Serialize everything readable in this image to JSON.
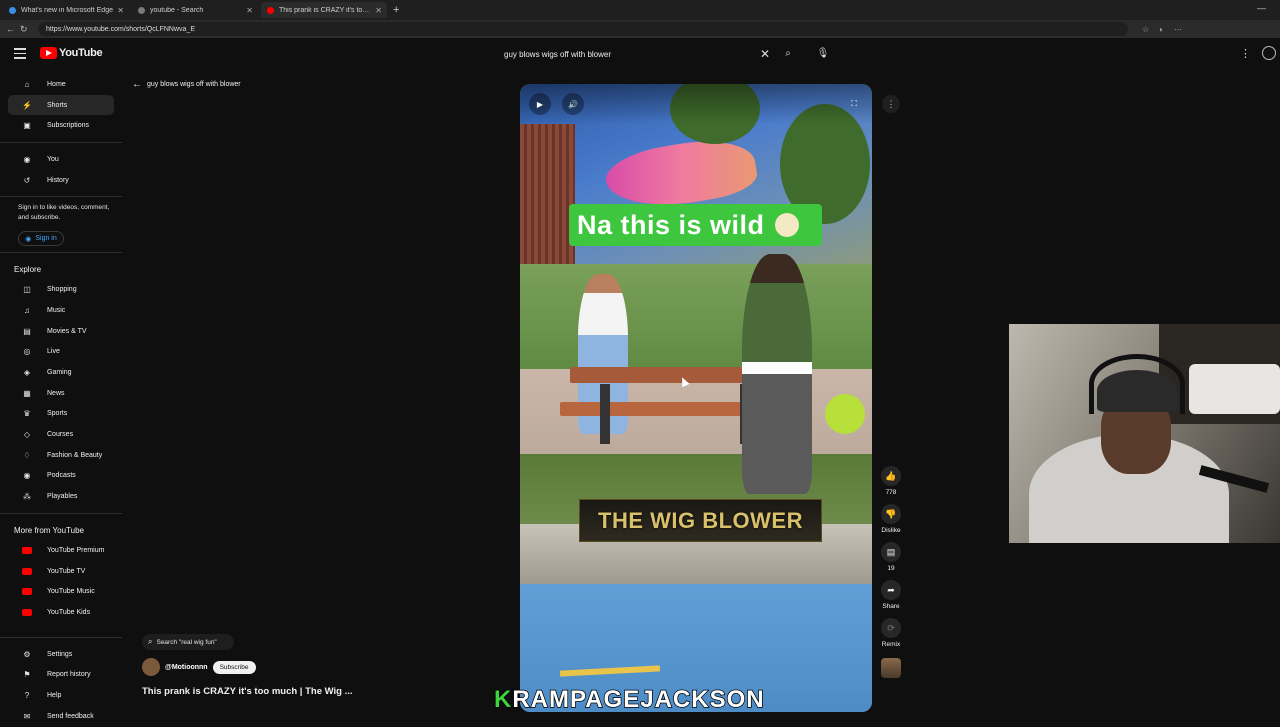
{
  "browser": {
    "tabs": [
      {
        "title": "What's new in Microsoft Edge",
        "color": "#3a8ee6"
      },
      {
        "title": "youtube - Search",
        "color": "#7a7a7a"
      },
      {
        "title": "This prank is CRAZY it's too much",
        "color": "#ff0000"
      }
    ],
    "url": "https://www.youtube.com/shorts/QcLFNNwva_E"
  },
  "header": {
    "logo_text": "YouTube",
    "search_query": "guy blows wigs off with blower"
  },
  "sidebar": {
    "main": [
      {
        "label": "Home",
        "icon": "home-icon",
        "glyph": "⌂"
      },
      {
        "label": "Shorts",
        "icon": "shorts-icon",
        "glyph": "⚡",
        "active": true
      },
      {
        "label": "Subscriptions",
        "icon": "subscriptions-icon",
        "glyph": "▣"
      }
    ],
    "you": [
      {
        "label": "You",
        "icon": "you-icon",
        "glyph": "◉"
      },
      {
        "label": "History",
        "icon": "history-icon",
        "glyph": "↺"
      }
    ],
    "signin_text": "Sign in to like videos, comment, and subscribe.",
    "signin_label": "Sign in",
    "explore_heading": "Explore",
    "explore": [
      {
        "label": "Shopping",
        "icon": "shopping-icon",
        "glyph": "◫"
      },
      {
        "label": "Music",
        "icon": "music-icon",
        "glyph": "♫"
      },
      {
        "label": "Movies & TV",
        "icon": "movies-icon",
        "glyph": "▤"
      },
      {
        "label": "Live",
        "icon": "live-icon",
        "glyph": "◎"
      },
      {
        "label": "Gaming",
        "icon": "gaming-icon",
        "glyph": "◈"
      },
      {
        "label": "News",
        "icon": "news-icon",
        "glyph": "▦"
      },
      {
        "label": "Sports",
        "icon": "sports-icon",
        "glyph": "♛"
      },
      {
        "label": "Courses",
        "icon": "courses-icon",
        "glyph": "◇"
      },
      {
        "label": "Fashion & Beauty",
        "icon": "fashion-icon",
        "glyph": "♢"
      },
      {
        "label": "Podcasts",
        "icon": "podcasts-icon",
        "glyph": "◉"
      },
      {
        "label": "Playables",
        "icon": "playables-icon",
        "glyph": "⁂"
      }
    ],
    "more_heading": "More from YouTube",
    "more": [
      {
        "label": "YouTube Premium",
        "icon": "youtube-premium-icon"
      },
      {
        "label": "YouTube TV",
        "icon": "youtube-tv-icon"
      },
      {
        "label": "YouTube Music",
        "icon": "youtube-music-icon"
      },
      {
        "label": "YouTube Kids",
        "icon": "youtube-kids-icon"
      }
    ],
    "bottom": [
      {
        "label": "Settings",
        "icon": "settings-icon",
        "glyph": "⚙"
      },
      {
        "label": "Report history",
        "icon": "report-flag-icon",
        "glyph": "⚑"
      },
      {
        "label": "Help",
        "icon": "help-icon",
        "glyph": "?"
      },
      {
        "label": "Send feedback",
        "icon": "feedback-icon",
        "glyph": "✉"
      }
    ]
  },
  "shorts": {
    "back_label": "guy blows wigs off with blower",
    "caption_text": "Na this is wild",
    "overlay_title": "THE WIG BLOWER",
    "like_count": "778",
    "dislike_label": "Dislike",
    "comment_count": "19",
    "share_label": "Share",
    "remix_label": "Remix",
    "related_search": "Search \"real wig fun\"",
    "channel": "@Motioonnn",
    "subscribe_label": "Subscribe",
    "title": "This prank is CRAZY it's too much | The Wig ..."
  },
  "streamer": {
    "brand_first": "K",
    "brand_rest": "RAMPAGEJACKSON"
  }
}
